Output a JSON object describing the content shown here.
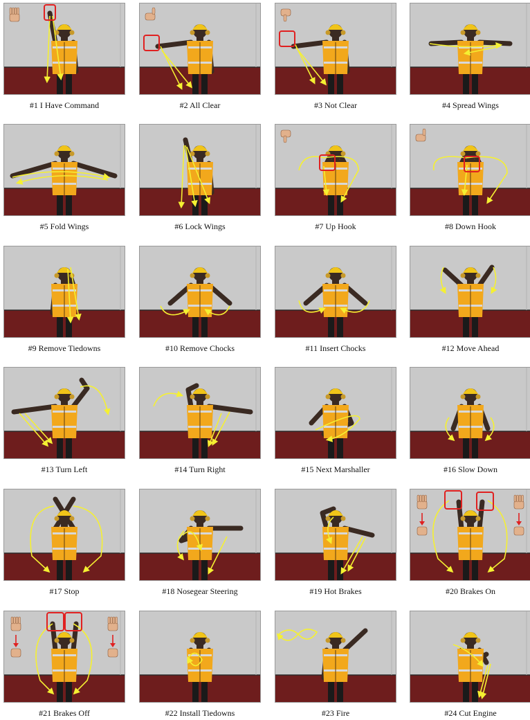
{
  "figure": {
    "colors": {
      "wall": "#c9c9c9",
      "floor": "#6e1d1d",
      "vest": "#f2a81c",
      "reflect": "#d8d8d8",
      "pants": "#1a1a1a",
      "helmet": "#f0c419",
      "skin": "#3a2a22",
      "trajectory": "#f5f032",
      "highlight": "#e02020",
      "arrow_red": "#e02020"
    },
    "panels": [
      {
        "label": "#1 I Have Command",
        "icon": "hand-icon"
      },
      {
        "label": "#2 All Clear",
        "icon": "thumb-up-icon"
      },
      {
        "label": "#3 Not Clear",
        "icon": "thumb-down-icon"
      },
      {
        "label": "#4 Spread Wings",
        "icon": ""
      },
      {
        "label": "#5 Fold Wings",
        "icon": ""
      },
      {
        "label": "#6 Lock Wings",
        "icon": ""
      },
      {
        "label": "#7 Up Hook",
        "icon": "thumb-down-icon"
      },
      {
        "label": "#8 Down Hook",
        "icon": "thumb-up-icon"
      },
      {
        "label": "#9 Remove Tiedowns",
        "icon": ""
      },
      {
        "label": "#10 Remove Chocks",
        "icon": ""
      },
      {
        "label": "#11 Insert Chocks",
        "icon": ""
      },
      {
        "label": "#12 Move Ahead",
        "icon": ""
      },
      {
        "label": "#13 Turn Left",
        "icon": ""
      },
      {
        "label": "#14 Turn Right",
        "icon": ""
      },
      {
        "label": "#15 Next Marshaller",
        "icon": ""
      },
      {
        "label": "#16 Slow Down",
        "icon": ""
      },
      {
        "label": "#17 Stop",
        "icon": ""
      },
      {
        "label": "#18 Nosegear Steering",
        "icon": ""
      },
      {
        "label": "#19 Hot Brakes",
        "icon": ""
      },
      {
        "label": "#20 Brakes On",
        "icon": "hand-open-to-fist-icon"
      },
      {
        "label": "#21 Brakes Off",
        "icon": "fist-to-hand-open-icon"
      },
      {
        "label": "#22 Install Tiedowns",
        "icon": ""
      },
      {
        "label": "#23 Fire",
        "icon": ""
      },
      {
        "label": "#24 Cut Engine",
        "icon": ""
      }
    ]
  }
}
